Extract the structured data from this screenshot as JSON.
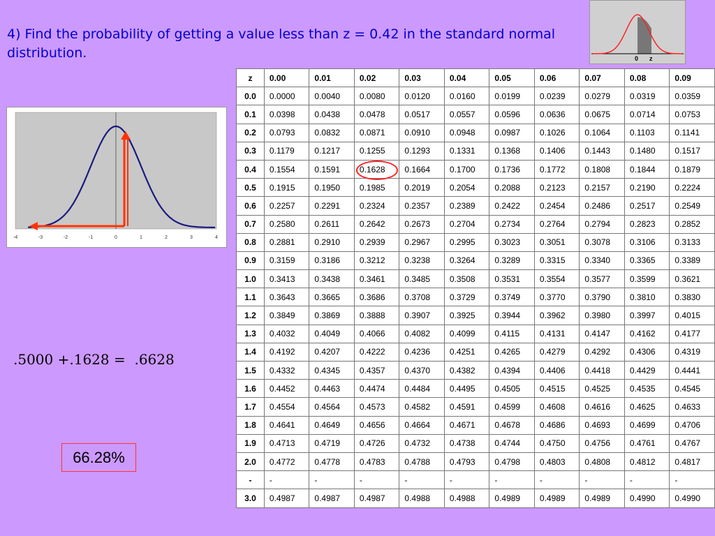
{
  "title": "4) Find the probability of getting a value less than z = 0.42 in the standard normal distribution.",
  "thumbnail": {
    "labels": [
      "0",
      "z"
    ]
  },
  "plot": {
    "x_ticks": [
      "-4",
      "-3",
      "-2",
      "-1",
      "0",
      "1",
      "2",
      "3",
      "4"
    ],
    "colors": {
      "curve": "#1a1a80",
      "arrow": "#ff3300",
      "mean_line": "#666666"
    }
  },
  "equation": ".5000 +.1628 =  .6628",
  "answer": "66.28%",
  "table": {
    "header": [
      "z",
      "0.00",
      "0.01",
      "0.02",
      "0.03",
      "0.04",
      "0.05",
      "0.06",
      "0.07",
      "0.08",
      "0.09"
    ],
    "rows": [
      {
        "z": "0.0",
        "v": [
          "0.0000",
          "0.0040",
          "0.0080",
          "0.0120",
          "0.0160",
          "0.0199",
          "0.0239",
          "0.0279",
          "0.0319",
          "0.0359"
        ]
      },
      {
        "z": "0.1",
        "v": [
          "0.0398",
          "0.0438",
          "0.0478",
          "0.0517",
          "0.0557",
          "0.0596",
          "0.0636",
          "0.0675",
          "0.0714",
          "0.0753"
        ]
      },
      {
        "z": "0.2",
        "v": [
          "0.0793",
          "0.0832",
          "0.0871",
          "0.0910",
          "0.0948",
          "0.0987",
          "0.1026",
          "0.1064",
          "0.1103",
          "0.1141"
        ]
      },
      {
        "z": "0.3",
        "v": [
          "0.1179",
          "0.1217",
          "0.1255",
          "0.1293",
          "0.1331",
          "0.1368",
          "0.1406",
          "0.1443",
          "0.1480",
          "0.1517"
        ]
      },
      {
        "z": "0.4",
        "v": [
          "0.1554",
          "0.1591",
          "0.1628",
          "0.1664",
          "0.1700",
          "0.1736",
          "0.1772",
          "0.1808",
          "0.1844",
          "0.1879"
        ]
      },
      {
        "z": "0.5",
        "v": [
          "0.1915",
          "0.1950",
          "0.1985",
          "0.2019",
          "0.2054",
          "0.2088",
          "0.2123",
          "0.2157",
          "0.2190",
          "0.2224"
        ]
      },
      {
        "z": "0.6",
        "v": [
          "0.2257",
          "0.2291",
          "0.2324",
          "0.2357",
          "0.2389",
          "0.2422",
          "0.2454",
          "0.2486",
          "0.2517",
          "0.2549"
        ]
      },
      {
        "z": "0.7",
        "v": [
          "0.2580",
          "0.2611",
          "0.2642",
          "0.2673",
          "0.2704",
          "0.2734",
          "0.2764",
          "0.2794",
          "0.2823",
          "0.2852"
        ]
      },
      {
        "z": "0.8",
        "v": [
          "0.2881",
          "0.2910",
          "0.2939",
          "0.2967",
          "0.2995",
          "0.3023",
          "0.3051",
          "0.3078",
          "0.3106",
          "0.3133"
        ]
      },
      {
        "z": "0.9",
        "v": [
          "0.3159",
          "0.3186",
          "0.3212",
          "0.3238",
          "0.3264",
          "0.3289",
          "0.3315",
          "0.3340",
          "0.3365",
          "0.3389"
        ]
      },
      {
        "z": "1.0",
        "v": [
          "0.3413",
          "0.3438",
          "0.3461",
          "0.3485",
          "0.3508",
          "0.3531",
          "0.3554",
          "0.3577",
          "0.3599",
          "0.3621"
        ]
      },
      {
        "z": "1.1",
        "v": [
          "0.3643",
          "0.3665",
          "0.3686",
          "0.3708",
          "0.3729",
          "0.3749",
          "0.3770",
          "0.3790",
          "0.3810",
          "0.3830"
        ]
      },
      {
        "z": "1.2",
        "v": [
          "0.3849",
          "0.3869",
          "0.3888",
          "0.3907",
          "0.3925",
          "0.3944",
          "0.3962",
          "0.3980",
          "0.3997",
          "0.4015"
        ]
      },
      {
        "z": "1.3",
        "v": [
          "0.4032",
          "0.4049",
          "0.4066",
          "0.4082",
          "0.4099",
          "0.4115",
          "0.4131",
          "0.4147",
          "0.4162",
          "0.4177"
        ]
      },
      {
        "z": "1.4",
        "v": [
          "0.4192",
          "0.4207",
          "0.4222",
          "0.4236",
          "0.4251",
          "0.4265",
          "0.4279",
          "0.4292",
          "0.4306",
          "0.4319"
        ]
      },
      {
        "z": "1.5",
        "v": [
          "0.4332",
          "0.4345",
          "0.4357",
          "0.4370",
          "0.4382",
          "0.4394",
          "0.4406",
          "0.4418",
          "0.4429",
          "0.4441"
        ]
      },
      {
        "z": "1.6",
        "v": [
          "0.4452",
          "0.4463",
          "0.4474",
          "0.4484",
          "0.4495",
          "0.4505",
          "0.4515",
          "0.4525",
          "0.4535",
          "0.4545"
        ]
      },
      {
        "z": "1.7",
        "v": [
          "0.4554",
          "0.4564",
          "0.4573",
          "0.4582",
          "0.4591",
          "0.4599",
          "0.4608",
          "0.4616",
          "0.4625",
          "0.4633"
        ]
      },
      {
        "z": "1.8",
        "v": [
          "0.4641",
          "0.4649",
          "0.4656",
          "0.4664",
          "0.4671",
          "0.4678",
          "0.4686",
          "0.4693",
          "0.4699",
          "0.4706"
        ]
      },
      {
        "z": "1.9",
        "v": [
          "0.4713",
          "0.4719",
          "0.4726",
          "0.4732",
          "0.4738",
          "0.4744",
          "0.4750",
          "0.4756",
          "0.4761",
          "0.4767"
        ]
      },
      {
        "z": "2.0",
        "v": [
          "0.4772",
          "0.4778",
          "0.4783",
          "0.4788",
          "0.4793",
          "0.4798",
          "0.4803",
          "0.4808",
          "0.4812",
          "0.4817"
        ]
      },
      {
        "z": "-",
        "v": [
          "-",
          "-",
          "-",
          "-",
          "-",
          "-",
          "-",
          "-",
          "-",
          "-"
        ]
      },
      {
        "z": "3.0",
        "v": [
          "0.4987",
          "0.4987",
          "0.4987",
          "0.4988",
          "0.4988",
          "0.4989",
          "0.4989",
          "0.4989",
          "0.4990",
          "0.4990"
        ]
      }
    ],
    "highlight": {
      "row": 4,
      "col": 2
    }
  }
}
